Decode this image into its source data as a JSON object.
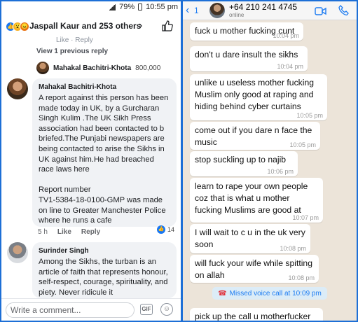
{
  "facebook": {
    "status_bar": {
      "battery": "79%",
      "time": "10:55 pm"
    },
    "header": {
      "reactions_summary": "Jaspall Kaur and 253 others"
    },
    "truncated_actions": "Like · Reply",
    "view_previous": "View 1 previous reply",
    "previous_reply": {
      "name": "Mahakal Bachitri-Khota",
      "count": "800,000"
    },
    "comments": [
      {
        "name": "Mahakal Bachitri-Khota",
        "text": "A report against this person has been made today in UK, by a Gurcharan Singh Kulim .The UK Sikh Press association had been contacted to b briefed.The Punjabi newspapers are being contacted to arise the Sikhs in UK against him.He had breached race laws here\n\nReport number\nTV1-5384-18-0100-GMP was made on line to Greater Manchester Police where he runs a cafe",
        "time": "5 h",
        "like_label": "Like",
        "reply_label": "Reply",
        "like_count": "14"
      },
      {
        "name": "Surinder Singh",
        "text": "Among the Sikhs, the turban is an article of faith that represents honour, self-respect, courage, spirituality, and piety. Never ridicule it"
      }
    ],
    "composer": {
      "placeholder": "Write a comment...",
      "gif_label": "GIF"
    }
  },
  "whatsapp": {
    "header": {
      "back_count": "1",
      "contact": "+64 210 241 4745",
      "status": "online"
    },
    "messages": [
      {
        "text": "fuck u mother fucking cunt",
        "time": "10:04 pm"
      },
      {
        "text": "don't u dare insult the sikhs",
        "time": "10:04 pm"
      },
      {
        "text": "unlike u useless mother fucking Muslim  only good at raping and hiding behind cyber curtains",
        "time": "10:05 pm"
      },
      {
        "text": "come out if you dare n face the music",
        "time": "10:05 pm"
      },
      {
        "text": "stop suckling up to najib",
        "time": "10:06 pm"
      },
      {
        "text": "learn to rape your own people coz that is what u mother fucking Muslims are good at",
        "time": "10:07 pm"
      },
      {
        "text": "I will wait to c u in the uk very soon",
        "time": "10:08 pm"
      },
      {
        "text": "will fuck your wife while spitting on allah",
        "time": "10:08 pm"
      },
      {
        "text": "pick up the call u motherfucker",
        "time": ""
      }
    ],
    "missed_call": "Missed voice call at 10:09 pm"
  },
  "colors": {
    "frame_blue": "#1d6fd6",
    "whatsapp_bg": "#ece4d9",
    "facebook_blue": "#1877f2"
  }
}
